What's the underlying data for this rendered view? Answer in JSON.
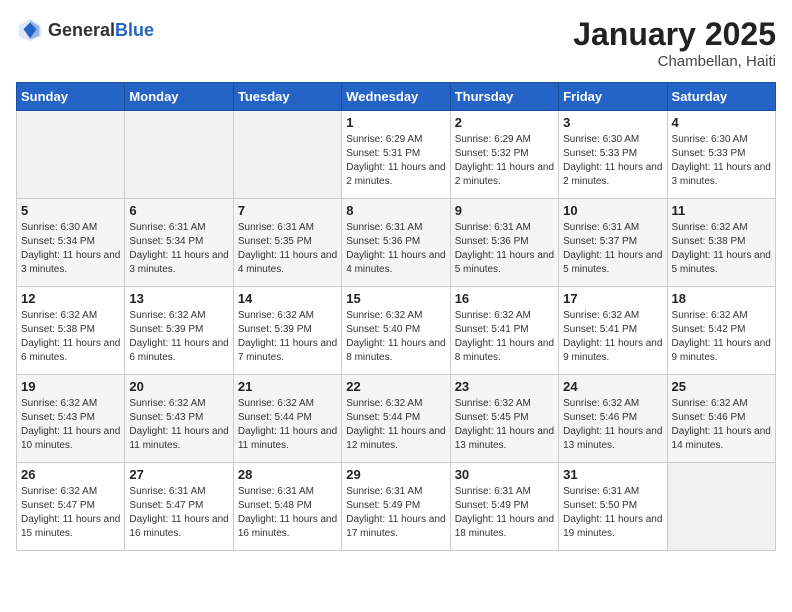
{
  "header": {
    "logo_general": "General",
    "logo_blue": "Blue",
    "month_year": "January 2025",
    "location": "Chambellan, Haiti"
  },
  "weekdays": [
    "Sunday",
    "Monday",
    "Tuesday",
    "Wednesday",
    "Thursday",
    "Friday",
    "Saturday"
  ],
  "weeks": [
    [
      {
        "day": "",
        "sunrise": "",
        "sunset": "",
        "daylight": ""
      },
      {
        "day": "",
        "sunrise": "",
        "sunset": "",
        "daylight": ""
      },
      {
        "day": "",
        "sunrise": "",
        "sunset": "",
        "daylight": ""
      },
      {
        "day": "1",
        "sunrise": "Sunrise: 6:29 AM",
        "sunset": "Sunset: 5:31 PM",
        "daylight": "Daylight: 11 hours and 2 minutes."
      },
      {
        "day": "2",
        "sunrise": "Sunrise: 6:29 AM",
        "sunset": "Sunset: 5:32 PM",
        "daylight": "Daylight: 11 hours and 2 minutes."
      },
      {
        "day": "3",
        "sunrise": "Sunrise: 6:30 AM",
        "sunset": "Sunset: 5:33 PM",
        "daylight": "Daylight: 11 hours and 2 minutes."
      },
      {
        "day": "4",
        "sunrise": "Sunrise: 6:30 AM",
        "sunset": "Sunset: 5:33 PM",
        "daylight": "Daylight: 11 hours and 3 minutes."
      }
    ],
    [
      {
        "day": "5",
        "sunrise": "Sunrise: 6:30 AM",
        "sunset": "Sunset: 5:34 PM",
        "daylight": "Daylight: 11 hours and 3 minutes."
      },
      {
        "day": "6",
        "sunrise": "Sunrise: 6:31 AM",
        "sunset": "Sunset: 5:34 PM",
        "daylight": "Daylight: 11 hours and 3 minutes."
      },
      {
        "day": "7",
        "sunrise": "Sunrise: 6:31 AM",
        "sunset": "Sunset: 5:35 PM",
        "daylight": "Daylight: 11 hours and 4 minutes."
      },
      {
        "day": "8",
        "sunrise": "Sunrise: 6:31 AM",
        "sunset": "Sunset: 5:36 PM",
        "daylight": "Daylight: 11 hours and 4 minutes."
      },
      {
        "day": "9",
        "sunrise": "Sunrise: 6:31 AM",
        "sunset": "Sunset: 5:36 PM",
        "daylight": "Daylight: 11 hours and 5 minutes."
      },
      {
        "day": "10",
        "sunrise": "Sunrise: 6:31 AM",
        "sunset": "Sunset: 5:37 PM",
        "daylight": "Daylight: 11 hours and 5 minutes."
      },
      {
        "day": "11",
        "sunrise": "Sunrise: 6:32 AM",
        "sunset": "Sunset: 5:38 PM",
        "daylight": "Daylight: 11 hours and 5 minutes."
      }
    ],
    [
      {
        "day": "12",
        "sunrise": "Sunrise: 6:32 AM",
        "sunset": "Sunset: 5:38 PM",
        "daylight": "Daylight: 11 hours and 6 minutes."
      },
      {
        "day": "13",
        "sunrise": "Sunrise: 6:32 AM",
        "sunset": "Sunset: 5:39 PM",
        "daylight": "Daylight: 11 hours and 6 minutes."
      },
      {
        "day": "14",
        "sunrise": "Sunrise: 6:32 AM",
        "sunset": "Sunset: 5:39 PM",
        "daylight": "Daylight: 11 hours and 7 minutes."
      },
      {
        "day": "15",
        "sunrise": "Sunrise: 6:32 AM",
        "sunset": "Sunset: 5:40 PM",
        "daylight": "Daylight: 11 hours and 8 minutes."
      },
      {
        "day": "16",
        "sunrise": "Sunrise: 6:32 AM",
        "sunset": "Sunset: 5:41 PM",
        "daylight": "Daylight: 11 hours and 8 minutes."
      },
      {
        "day": "17",
        "sunrise": "Sunrise: 6:32 AM",
        "sunset": "Sunset: 5:41 PM",
        "daylight": "Daylight: 11 hours and 9 minutes."
      },
      {
        "day": "18",
        "sunrise": "Sunrise: 6:32 AM",
        "sunset": "Sunset: 5:42 PM",
        "daylight": "Daylight: 11 hours and 9 minutes."
      }
    ],
    [
      {
        "day": "19",
        "sunrise": "Sunrise: 6:32 AM",
        "sunset": "Sunset: 5:43 PM",
        "daylight": "Daylight: 11 hours and 10 minutes."
      },
      {
        "day": "20",
        "sunrise": "Sunrise: 6:32 AM",
        "sunset": "Sunset: 5:43 PM",
        "daylight": "Daylight: 11 hours and 11 minutes."
      },
      {
        "day": "21",
        "sunrise": "Sunrise: 6:32 AM",
        "sunset": "Sunset: 5:44 PM",
        "daylight": "Daylight: 11 hours and 11 minutes."
      },
      {
        "day": "22",
        "sunrise": "Sunrise: 6:32 AM",
        "sunset": "Sunset: 5:44 PM",
        "daylight": "Daylight: 11 hours and 12 minutes."
      },
      {
        "day": "23",
        "sunrise": "Sunrise: 6:32 AM",
        "sunset": "Sunset: 5:45 PM",
        "daylight": "Daylight: 11 hours and 13 minutes."
      },
      {
        "day": "24",
        "sunrise": "Sunrise: 6:32 AM",
        "sunset": "Sunset: 5:46 PM",
        "daylight": "Daylight: 11 hours and 13 minutes."
      },
      {
        "day": "25",
        "sunrise": "Sunrise: 6:32 AM",
        "sunset": "Sunset: 5:46 PM",
        "daylight": "Daylight: 11 hours and 14 minutes."
      }
    ],
    [
      {
        "day": "26",
        "sunrise": "Sunrise: 6:32 AM",
        "sunset": "Sunset: 5:47 PM",
        "daylight": "Daylight: 11 hours and 15 minutes."
      },
      {
        "day": "27",
        "sunrise": "Sunrise: 6:31 AM",
        "sunset": "Sunset: 5:47 PM",
        "daylight": "Daylight: 11 hours and 16 minutes."
      },
      {
        "day": "28",
        "sunrise": "Sunrise: 6:31 AM",
        "sunset": "Sunset: 5:48 PM",
        "daylight": "Daylight: 11 hours and 16 minutes."
      },
      {
        "day": "29",
        "sunrise": "Sunrise: 6:31 AM",
        "sunset": "Sunset: 5:49 PM",
        "daylight": "Daylight: 11 hours and 17 minutes."
      },
      {
        "day": "30",
        "sunrise": "Sunrise: 6:31 AM",
        "sunset": "Sunset: 5:49 PM",
        "daylight": "Daylight: 11 hours and 18 minutes."
      },
      {
        "day": "31",
        "sunrise": "Sunrise: 6:31 AM",
        "sunset": "Sunset: 5:50 PM",
        "daylight": "Daylight: 11 hours and 19 minutes."
      },
      {
        "day": "",
        "sunrise": "",
        "sunset": "",
        "daylight": ""
      }
    ]
  ]
}
